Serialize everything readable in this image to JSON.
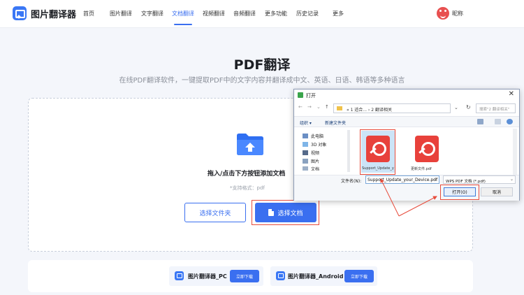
{
  "nav": {
    "logo_text": "图片翻译器",
    "items": [
      "首页",
      "图片翻译",
      "文字翻译",
      "文档翻译",
      "视频翻译",
      "音频翻译",
      "更多功能",
      "历史记录",
      "更多"
    ],
    "active_item": "文档翻译",
    "user_name": "昵称"
  },
  "hero": {
    "title": "PDF翻译",
    "subtitle": "在线PDF翻译软件，一键提取PDF中的文字内容并翻译成中文、英语、日语、韩语等多种语言"
  },
  "upload": {
    "drop_hint": "拖入/点击下方按钮添加文档",
    "format_hint": "*支持格式：pdf",
    "select_folder_label": "选择文件夹",
    "select_doc_label": "选择文档"
  },
  "downloads": [
    {
      "name": "图片翻译器_PC",
      "button": "立即下载"
    },
    {
      "name": "图片翻译器_Android",
      "button": "立即下载"
    }
  ],
  "dialog": {
    "title": "打开",
    "address": "« 1 适合... › 2 翻译相关",
    "search_placeholder": "搜索\"2 翻译相关\"",
    "toolbar": {
      "organize": "组织 ▾",
      "new_folder": "新建文件夹"
    },
    "sidebar": [
      "此电脑",
      "3D 对象",
      "视频",
      "图片",
      "文档"
    ],
    "files": [
      {
        "name": "Support_Update_your_Device.pdf",
        "selected": true
      },
      {
        "name": "更新文件.pdf",
        "selected": false
      }
    ],
    "filename_label": "文件名(N):",
    "filename_value": "Support_Update_your_Device.pdf",
    "filetype_value": "WPS PDF 文档 (*.pdf)",
    "open_label": "打开(O)",
    "cancel_label": "取消"
  },
  "colors": {
    "accent": "#3a6ff0",
    "highlight": "#e74c3c",
    "pdf_red": "#e8413b"
  }
}
